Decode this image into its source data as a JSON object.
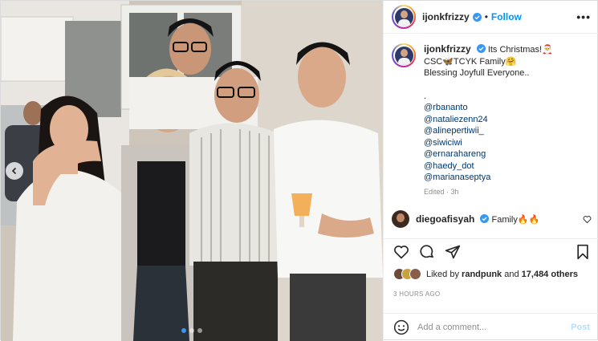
{
  "header": {
    "username": "ijonkfrizzy",
    "separator": "•",
    "follow_label": "Follow",
    "more_label": "•••"
  },
  "caption": {
    "username": "ijonkfrizzy",
    "lines": [
      "Its Christmas!🎅",
      "CSC🦋TCYK Family🤗",
      "Blessing Joyfull Everyone.."
    ],
    "dot": ".",
    "mentions": [
      "@rbananto",
      "@nataliezenn24",
      "@alinepertiwii_",
      "@siwiciwi",
      "@ernarahareng",
      "@haedy_dot",
      "@marianaseptya"
    ],
    "edited": "Edited · 3h"
  },
  "comment": {
    "username": "diegoafisyah",
    "text": "Family🔥🔥"
  },
  "likes": {
    "prefix": "Liked by",
    "user": "randpunk",
    "joiner": "and",
    "count": "17,484 others"
  },
  "time_ago": "3 HOURS AGO",
  "add_comment": {
    "placeholder": "Add a comment...",
    "post_label": "Post"
  },
  "carousel": {
    "total": 3,
    "active": 1
  },
  "colors": {
    "accent": "#0095f6",
    "verified": "#3897f0",
    "post_disabled": "#b2dffc"
  }
}
